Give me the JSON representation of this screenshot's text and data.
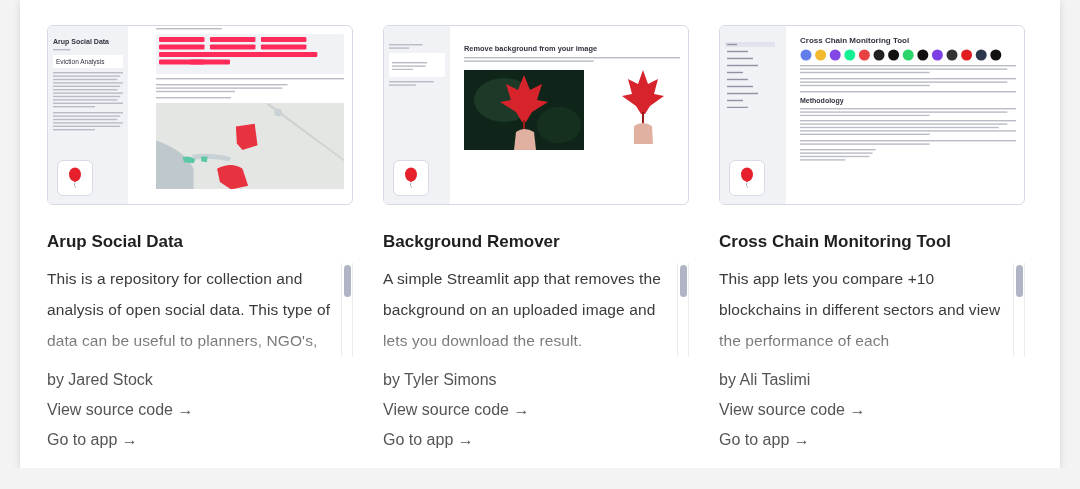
{
  "cards": [
    {
      "title": "Arup Social Data",
      "description": "This is a repository for collection and analysis of open social data. This type of data can be useful to planners, NGO's,",
      "author": "by Jared Stock",
      "links": [
        "View source code →",
        "Go to app →"
      ],
      "preview": {
        "kind": "dashboard",
        "sidebar_title": "Arup Social Data",
        "select_value": "Eviction Analysis"
      }
    },
    {
      "title": "Background Remover",
      "description": "A simple Streamlit app that removes the background on an uploaded image and lets you download the result.",
      "author": "by Tyler Simons",
      "links": [
        "View source code →",
        "Go to app →"
      ],
      "preview": {
        "kind": "image_tool",
        "heading": "Remove background from your image"
      }
    },
    {
      "title": "Cross Chain Monitoring Tool",
      "description": "This app lets you compare +10 blockchains in different sectors and view the performance of each",
      "author": "by Ali Taslimi",
      "links": [
        "View source code →",
        "Go to app →"
      ],
      "preview": {
        "kind": "article",
        "heading": "Cross Chain Monitoring Tool",
        "section": "Methodology"
      }
    }
  ]
}
